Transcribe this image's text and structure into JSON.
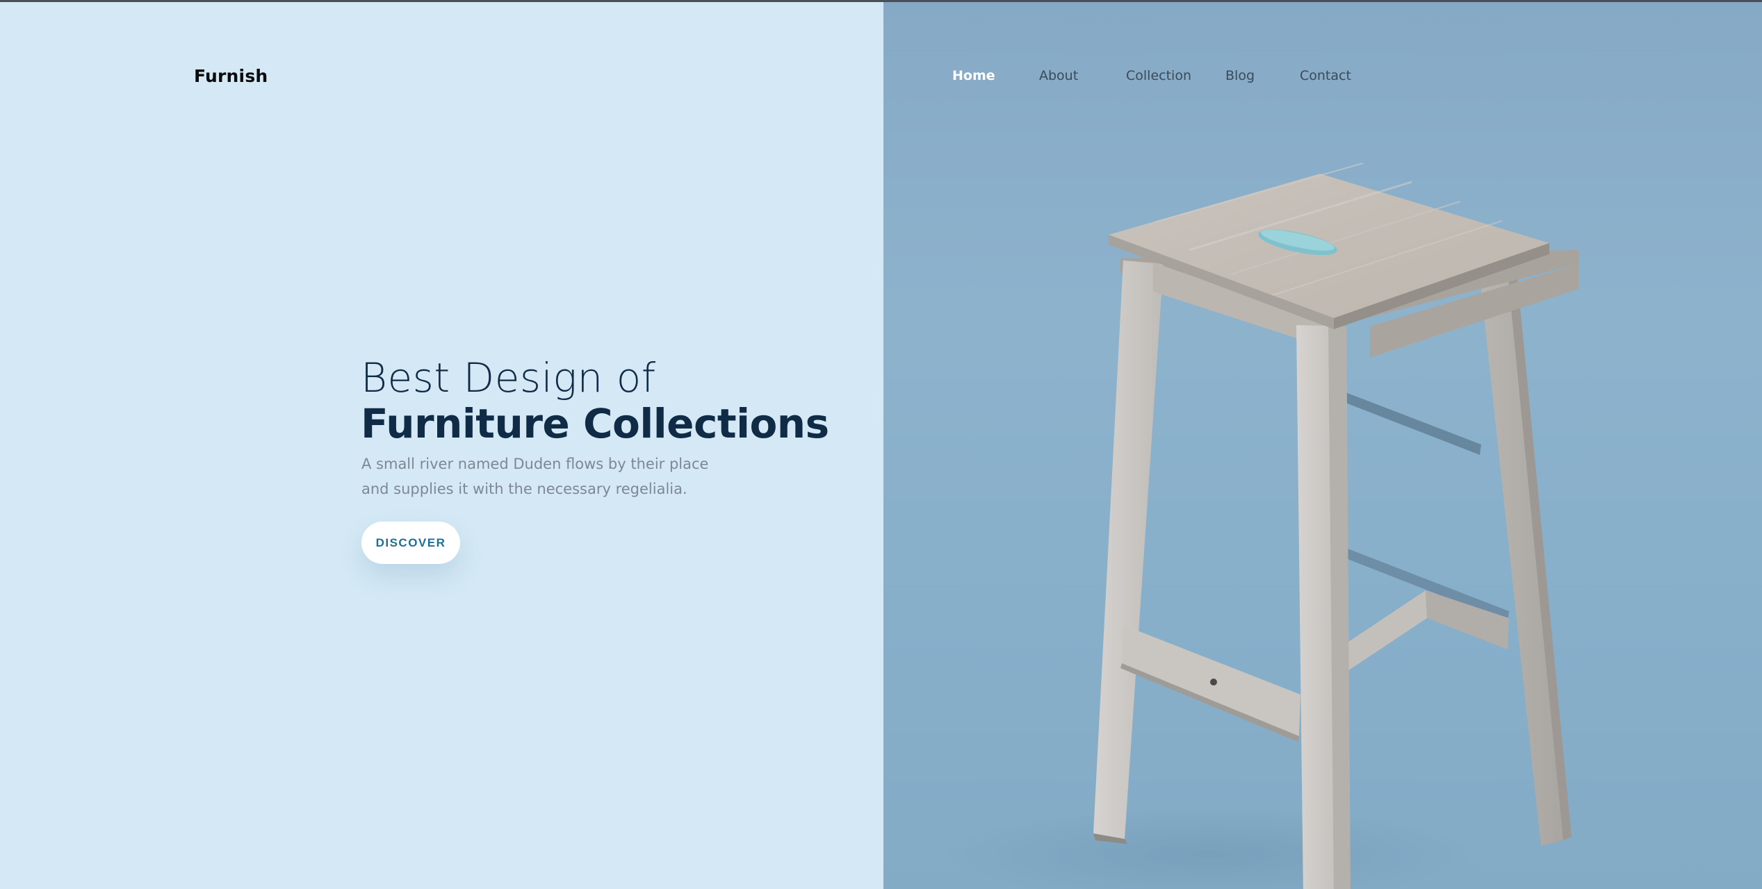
{
  "brand": {
    "name": "Furnish"
  },
  "nav": {
    "items": [
      {
        "label": "Home",
        "active": true
      },
      {
        "label": "About",
        "active": false
      },
      {
        "label": "Collection",
        "active": false
      },
      {
        "label": "Blog",
        "active": false
      },
      {
        "label": "Contact",
        "active": false
      }
    ]
  },
  "hero": {
    "title_light": "Best Design of",
    "title_bold": "Furniture Collections",
    "description_line1": "A small river named Duden flows by their place",
    "description_line2": "and supplies it with the necessary regelialia.",
    "cta_label": "DISCOVER"
  },
  "colors": {
    "left_background": "#d4e9f5",
    "right_background": "#8db2cc",
    "heading": "#0f2b45",
    "cta_text": "#1f6f92",
    "nav_active": "#ffffff",
    "nav_inactive": "#3a4a58"
  },
  "hero_image": {
    "subject": "wooden-bar-stool"
  }
}
